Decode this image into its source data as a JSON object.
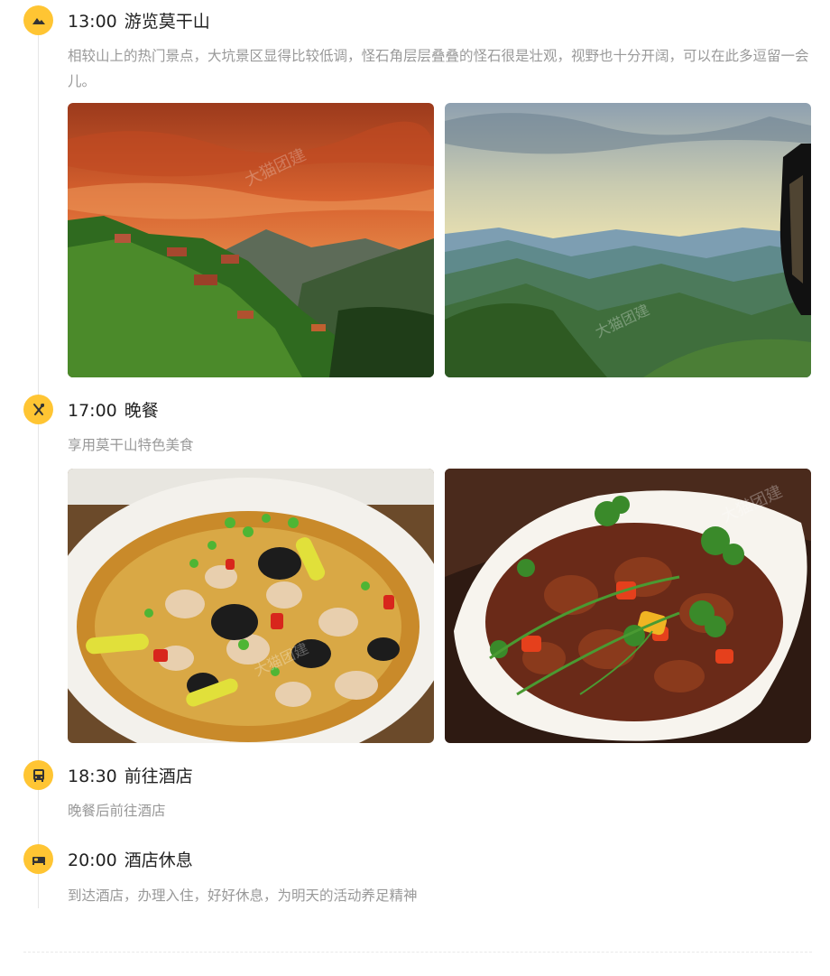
{
  "itinerary": [
    {
      "time": "13:00",
      "title": "游览莫干山",
      "icon": "mountain-icon",
      "desc": "相较山上的热门景点，大坑景区显得比较低调，怪石角层层叠叠的怪石很是壮观，视野也十分开阔，可以在此多逗留一会儿。",
      "photos": [
        {
          "name": "sunset-mountain-village-photo",
          "watermark": "大猫团建"
        },
        {
          "name": "misty-mountain-range-photo",
          "watermark": "大猫团建"
        }
      ]
    },
    {
      "time": "17:00",
      "title": "晚餐",
      "icon": "utensils-icon",
      "desc": "享用莫干山特色美食",
      "photos": [
        {
          "name": "frog-stirfry-dish-photo",
          "watermark": "大猫团建"
        },
        {
          "name": "spicy-meat-dish-photo",
          "watermark": "大猫团建"
        }
      ]
    },
    {
      "time": "18:30",
      "title": "前往酒店",
      "icon": "bus-icon",
      "desc": "晚餐后前往酒店"
    },
    {
      "time": "20:00",
      "title": "酒店休息",
      "icon": "bed-icon",
      "desc": "到达酒店，办理入住，好好休息，为明天的活动养足精神"
    }
  ],
  "colors": {
    "accent": "#ffc533",
    "title_text": "#222222",
    "desc_text": "#999999",
    "timeline": "#e6e6e6"
  }
}
